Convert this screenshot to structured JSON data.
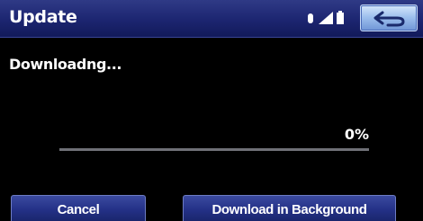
{
  "header": {
    "title": "Update",
    "icons": [
      "bluetooth-icon",
      "signal-strength-icon",
      "battery-icon"
    ],
    "back_icon": "back-arrow-icon"
  },
  "main": {
    "message": "Downloadng...",
    "progress_label": "0%",
    "progress_fraction": 0
  },
  "buttons": {
    "cancel_label": "Cancel",
    "background_label": "Download in Background"
  },
  "colors": {
    "header": "#1c2570",
    "background": "#000000",
    "accent_button": "#9fc1ee"
  }
}
